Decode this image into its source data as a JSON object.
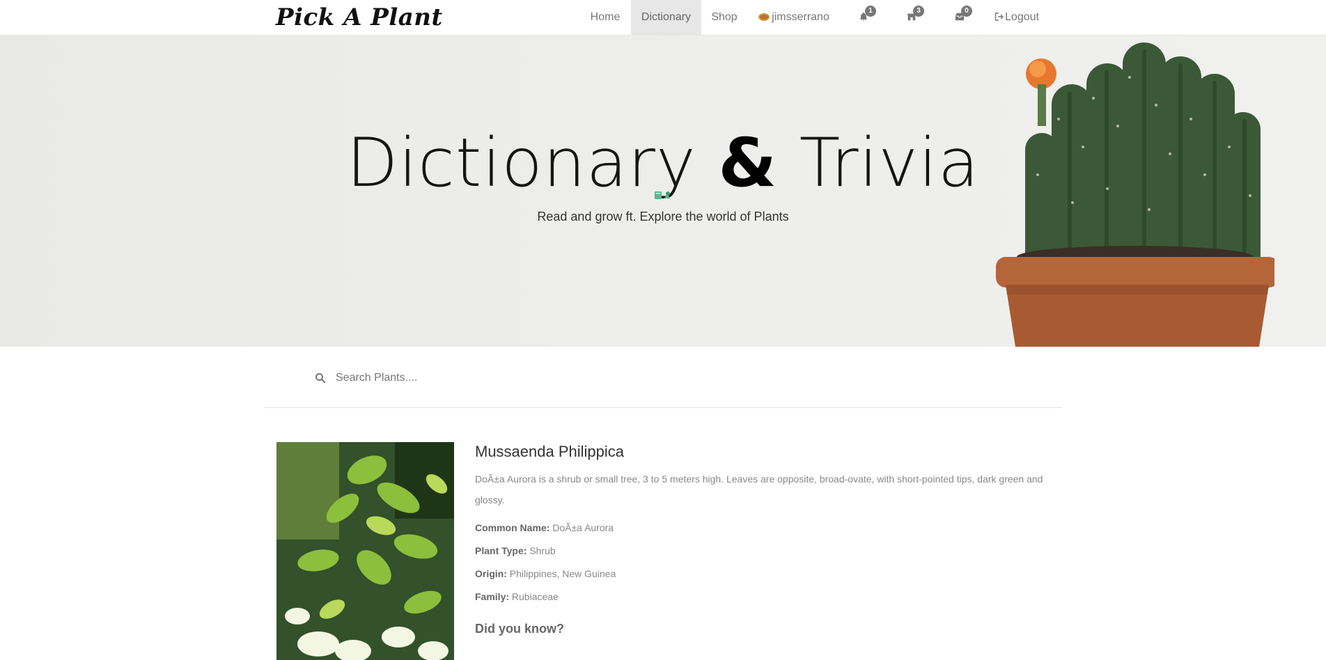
{
  "nav": {
    "brand": "Pick A Plant",
    "home": "Home",
    "dictionary": "Dictionary",
    "shop": "Shop",
    "username": "jimsserrano",
    "notifications_count": "1",
    "store_count": "3",
    "inbox_count": "0",
    "logout": "Logout"
  },
  "hero": {
    "title_part1": "Dictionary",
    "title_amp": "&",
    "title_part2": "Trivia",
    "subtitle": "Read and grow ft. Explore the world of Plants"
  },
  "search": {
    "placeholder": "Search Plants...."
  },
  "plant": {
    "name": "Mussaenda Philippica",
    "description": "DoÃ±a Aurora is a shrub or small tree, 3 to 5 meters high. Leaves are opposite, broad-ovate, with short-pointed tips, dark green and glossy.",
    "common_name_label": "Common Name:",
    "common_name": "DoÃ±a Aurora",
    "plant_type_label": "Plant Type:",
    "plant_type": "Shrub",
    "origin_label": "Origin:",
    "origin": "Philippines, New Guinea",
    "family_label": "Family:",
    "family": "Rubiaceae",
    "did_you_know": "Did you know?"
  },
  "colors": {
    "nav_active_bg": "#e7e7e7",
    "badge": "#777777",
    "pot": "#b5653a",
    "cactus": "#3d5a3a"
  }
}
